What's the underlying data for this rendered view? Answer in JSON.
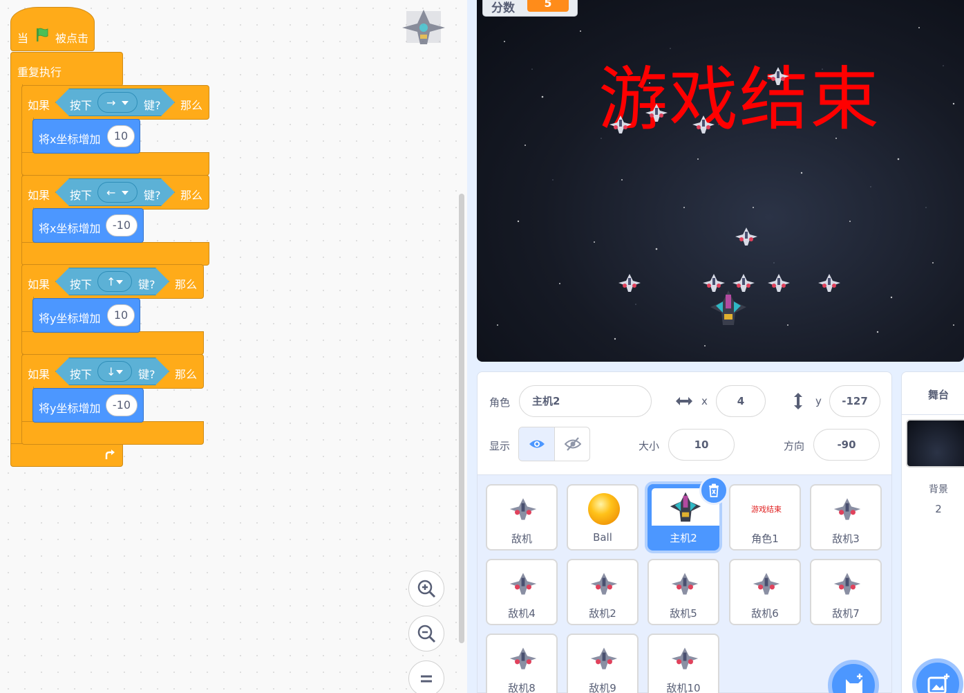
{
  "code": {
    "hat": {
      "when": "当",
      "clicked": "被点击"
    },
    "forever": "重复执行",
    "ifs": [
      {
        "if": "如果",
        "press": "按下",
        "key": "→",
        "key_suffix": "键?",
        "then": "那么",
        "action": "将x坐标增加",
        "value": "10"
      },
      {
        "if": "如果",
        "press": "按下",
        "key": "←",
        "key_suffix": "键?",
        "then": "那么",
        "action": "将x坐标增加",
        "value": "-10"
      },
      {
        "if": "如果",
        "press": "按下",
        "key": "↑",
        "key_suffix": "键?",
        "then": "那么",
        "action": "将y坐标增加",
        "value": "10"
      },
      {
        "if": "如果",
        "press": "按下",
        "key": "↓",
        "key_suffix": "键?",
        "then": "那么",
        "action": "将y坐标增加",
        "value": "-10"
      }
    ],
    "zoom": {
      "in": "zoom-in-icon",
      "out": "zoom-out-icon",
      "reset": "zoom-reset-icon"
    }
  },
  "stage": {
    "score_label": "分数",
    "score_value": "5",
    "game_over": "游戏结束"
  },
  "sprite_info": {
    "sprite_label": "角色",
    "sprite_name": "主机2",
    "x_label": "x",
    "x_value": "4",
    "y_label": "y",
    "y_value": "-127",
    "show_label": "显示",
    "size_label": "大小",
    "size_value": "10",
    "direction_label": "方向",
    "direction_value": "-90"
  },
  "sprites": [
    "敌机",
    "Ball",
    "主机2",
    "角色1",
    "敌机3",
    "敌机4",
    "敌机2",
    "敌机5",
    "敌机6",
    "敌机7",
    "敌机8",
    "敌机9",
    "敌机10"
  ],
  "selected_sprite": "主机2",
  "sprite1_thumb_text": "游戏结束",
  "stage_pane": {
    "title": "舞台",
    "backdrop_label": "背景",
    "backdrop_count": "2"
  },
  "colors": {
    "events": "#ffab19",
    "sensing": "#5cb1d6",
    "motion": "#4c97ff",
    "accent": "#4c97ff",
    "game_over": "#ff0000",
    "score": "#ff8c1a"
  }
}
